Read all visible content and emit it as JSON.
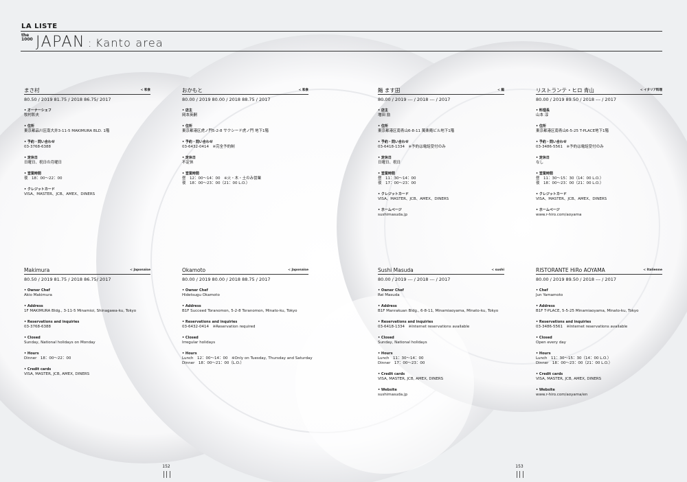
{
  "header": {
    "brand": "LA LISTE",
    "mark_top": "the",
    "mark_bottom": "1000",
    "country": "JAPAN",
    "separator": ":",
    "region": "Kanto area"
  },
  "pages": {
    "left": "152",
    "right": "153"
  },
  "cards": {
    "jp_makimura": {
      "name": "まさ村",
      "category": "< 和食",
      "scores": "80.50 / 2019    81.75 / 2018    86.75/ 2017",
      "s1_label": "• オーナーシェフ",
      "s1_v1": "牧村彰夫",
      "s2_label": "• 住所",
      "s2_v1": "東京都品川区南大井3-11-5 MAKIMURA BLD. 1階",
      "s3_label": "• 予約・問い合わせ",
      "s3_v1": "03-3768-6388",
      "s4_label": "• 定休日",
      "s4_v1": "日曜日、祝日の月曜日",
      "s5_label": "• 営業時間",
      "s5_v1": "夜　18：00〜22：00",
      "s6_label": "• クレジットカード",
      "s6_v1": "VISA、MASTER、JCB、AMEX、DINERS"
    },
    "jp_okamoto": {
      "name": "おかもと",
      "category": "< 和食",
      "scores": "80.00 / 2019    80.00 / 2018    88.75 / 2017",
      "s1_label": "• 店主",
      "s1_v1": "岡本英嗣",
      "s2_label": "• 住所",
      "s2_v1": "東京都港区虎ノ門5-2-8 サクシード虎ノ門 地下1階",
      "s3_label": "• 予約・問い合わせ",
      "s3_v1": "03-6432-0414　※完全予約制",
      "s4_label": "• 定休日",
      "s4_v1": "不定休",
      "s5_label": "• 営業時間",
      "s5_v1": "昼　12：00〜14：00　※火・木・土のみ営業",
      "s5_v2": "夜　18：00〜23：00（21：00 L.O.）"
    },
    "jp_masuda": {
      "name": "鮨 ます田",
      "category": "< 鮨",
      "scores": "80.00 / 2019    --- / 2018    --- / 2017",
      "s1_label": "• 店主",
      "s1_v1": "増田 励",
      "s2_label": "• 住所",
      "s2_v1": "東京都港区南青山6-8-11 萬楽庵ビル地下1階",
      "s3_label": "• 予約・問い合わせ",
      "s3_v1": "03-6418-1334　※予約は電話受付のみ",
      "s4_label": "• 定休日",
      "s4_v1": "日曜日、祝日",
      "s5_label": "• 営業時間",
      "s5_v1": "昼　11：30〜14：00",
      "s5_v2": "夜　17：00〜23：00",
      "s6_label": "• クレジットカード",
      "s6_v1": "VISA、MASTER、JCB、AMEX、DINERS",
      "s7_label": "• ホームページ",
      "s7_v1": "sushimasuda.jp"
    },
    "jp_hiro": {
      "name": "リストランテ・ヒロ 青山",
      "category": "< イタリア料理",
      "scores": "80.00 / 2019    89.50 / 2018    --- / 2017",
      "s1_label": "• 料理長",
      "s1_v1": "山本 淳",
      "s2_label": "• 住所",
      "s2_v1": "東京都港区南青山6-5-25 T-PLACE地下1階",
      "s3_label": "• 予約・問い合わせ",
      "s3_v1": "03-3486-5561　※予約は電話受付のみ",
      "s4_label": "• 定休日",
      "s4_v1": "なし",
      "s5_label": "• 営業時間",
      "s5_v1": "昼　11：30〜15：30（14：00 L.O.）",
      "s5_v2": "夜　18：00〜23：00（21：00 L.O.）",
      "s6_label": "• クレジットカード",
      "s6_v1": "VISA、MASTER、JCB、AMEX、DINERS",
      "s7_label": "• ホームページ",
      "s7_v1": "www.r-hiro.com/aoyama"
    },
    "en_makimura": {
      "name": "Makimura",
      "category": "< Japonaise",
      "scores": "80.50 / 2019    81.75 / 2018    86.75/ 2017",
      "s1_label": "• Owner Chef",
      "s1_v1": "Akio Makimura",
      "s2_label": "• Address",
      "s2_v1": "1F MAKIMURA Bldg., 3-11-5 Minamioi, Shinagawa-ku, Tokyo",
      "s3_label": "• Reservations and inquiries",
      "s3_v1": "03-3768-6388",
      "s4_label": "• Closed",
      "s4_v1": "Sunday, National holidays on Monday",
      "s5_label": "• Hours",
      "s5_v1": "Dinner　18：00〜22：00",
      "s6_label": "• Credit cards",
      "s6_v1": "VISA, MASTER, JCB, AMEX, DINERS"
    },
    "en_okamoto": {
      "name": "Okamoto",
      "category": "< Japonaise",
      "scores": "80.00 / 2019    80.00 / 2018    88.75 / 2017",
      "s1_label": "• Owner Chef",
      "s1_v1": "Hidetsugu Okamoto",
      "s2_label": "• Address",
      "s2_v1": "B1F Succeed Toranomon, 5-2-8 Toranomon, Minato-ku, Tokyo",
      "s3_label": "• Reservations and inquiries",
      "s3_v1": "03-6432-0414　※Reservation required",
      "s4_label": "• Closed",
      "s4_v1": "Irregular holidays",
      "s5_label": "• Hours",
      "s5_v1": "Lunch　12：00〜14：00　※Only on Tuesday, Thursday and Saturday",
      "s5_v2": "Dinner　18：00〜21：00（L.O.）"
    },
    "en_masuda": {
      "name": "Sushi Masuda",
      "category": "< sushi",
      "scores": "80.00 / 2019    --- / 2018    --- / 2017",
      "s1_label": "• Owner Chef",
      "s1_v1": "Rei Masuda",
      "s2_label": "• Address",
      "s2_v1": "B1F Manrakuan Bldg., 6-8-11, Minamiaoyama, Minato-ku, Tokyo",
      "s3_label": "• Reservations and inquiries",
      "s3_v1": "03-6418-1334　※Internet reservations available",
      "s4_label": "• Closed",
      "s4_v1": "Sunday, National holidays",
      "s5_label": "• Hours",
      "s5_v1": "Lunch　11：30〜14：00",
      "s5_v2": "Dinner　17：00〜23：00",
      "s6_label": "• Credit cards",
      "s6_v1": "VISA, MASTER, JCB, AMEX, DINERS",
      "s7_label": "• Website",
      "s7_v1": "sushimasuda.jp"
    },
    "en_hiro": {
      "name": "RISTORANTE HiRo AOYAMA",
      "category": "< Italienne",
      "scores": "80.00 / 2019    89.50 / 2018    --- / 2017",
      "s1_label": "• Chef",
      "s1_v1": "Jun Yamamoto",
      "s2_label": "• Address",
      "s2_v1": "B1F T-PLACE, 5-5-25 Minamiaoyama, Minato-ku, Tokyo",
      "s3_label": "• Reservations and inquiries",
      "s3_v1": "03-3486-5561　※Internet reservations available",
      "s4_label": "• Closed",
      "s4_v1": "Open every day",
      "s5_label": "• Hours",
      "s5_v1": "Lunch　11：30〜15：30（14：00 L.O.）",
      "s5_v2": "Dinner　18：00〜23：00（21：00 L.O.）",
      "s6_label": "• Credit cards",
      "s6_v1": "VISA, MASTER, JCB, AMEX, DINERS",
      "s7_label": "• Website",
      "s7_v1": "www.r-hiro.com/aoyama/en"
    }
  }
}
